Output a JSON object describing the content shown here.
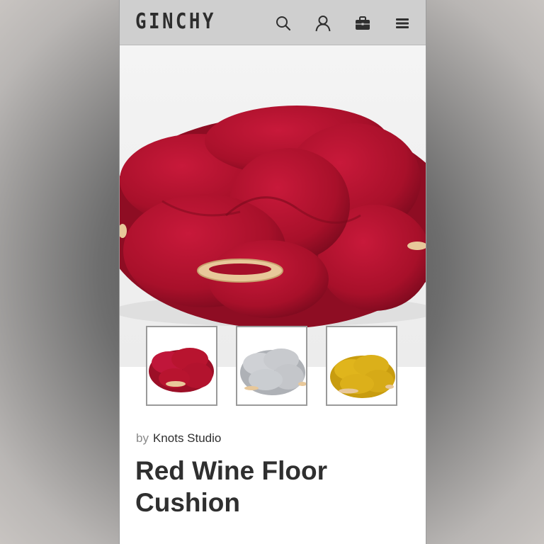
{
  "header": {
    "logo": "GINCHY",
    "icons": [
      "search-icon",
      "user-icon",
      "bag-icon",
      "menu-icon"
    ]
  },
  "product": {
    "by_label": "by",
    "brand": "Knots Studio",
    "title": "Red Wine Floor Cushion",
    "thumbnails": [
      {
        "name": "red",
        "color": "#b4122e"
      },
      {
        "name": "grey",
        "color": "#c9cbcf"
      },
      {
        "name": "yellow",
        "color": "#dcb01a"
      }
    ]
  },
  "colors": {
    "header_bg": "#cfcfcf",
    "text": "#2f2f2f",
    "ring_wood": "#e8c89a"
  }
}
